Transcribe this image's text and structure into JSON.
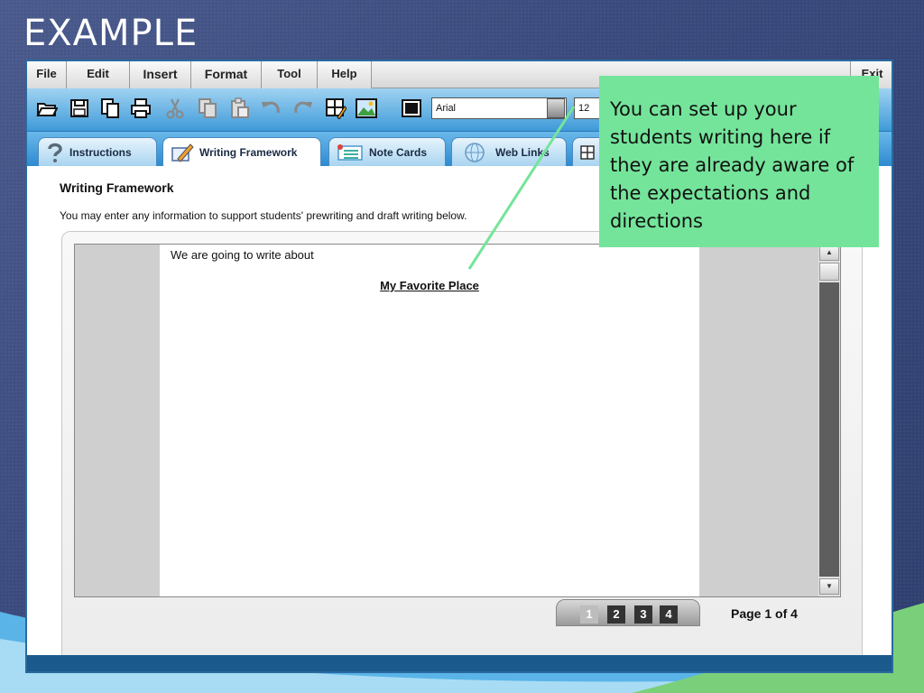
{
  "slide": {
    "title": "EXAMPLE"
  },
  "menu": {
    "items": [
      {
        "label": "File"
      },
      {
        "label": "Edit"
      },
      {
        "label": "Insert"
      },
      {
        "label": "Format"
      },
      {
        "label": "Tool"
      },
      {
        "label": "Help"
      }
    ],
    "exit_label": "Exit"
  },
  "toolbar": {
    "font_family_value": "Arial",
    "font_size_value": "12",
    "icons": [
      "open-folder-icon",
      "save-icon",
      "copy-doc-icon",
      "print-icon",
      "cut-icon",
      "copy-icon",
      "paste-icon",
      "undo-icon",
      "redo-icon",
      "table-edit-icon",
      "image-icon",
      "color-icon"
    ]
  },
  "tabs": [
    {
      "label": "Instructions",
      "icon": "question-icon",
      "active": false
    },
    {
      "label": "Writing Framework",
      "icon": "pencil-icon",
      "active": true
    },
    {
      "label": "Note Cards",
      "icon": "note-card-icon",
      "active": false
    },
    {
      "label": "Web Links",
      "icon": "globe-icon",
      "active": false
    }
  ],
  "content": {
    "header": "Writing Framework",
    "subtitle": "You may enter any information to support students' prewriting and draft writing below.",
    "editor_line1": "We are going to write about",
    "editor_line2": "My Favorite Place"
  },
  "pager": {
    "pages": [
      "1",
      "2",
      "3",
      "4"
    ],
    "current": 1,
    "label": "Page 1 of 4"
  },
  "callout": {
    "text": "You can set up your students writing here if they are already aware of the expectations and directions"
  },
  "colors": {
    "callout_bg": "#74e49a",
    "toolbar_blue": "#3f9ad8",
    "slide_bg": "#3a4a7c"
  }
}
